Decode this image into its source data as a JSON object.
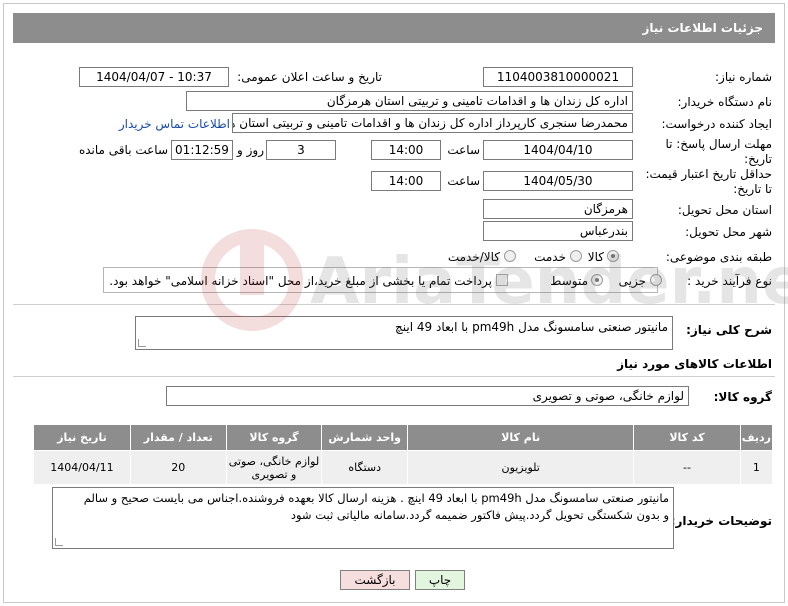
{
  "header": {
    "title": "جزئیات اطلاعات نیاز"
  },
  "fields": {
    "need_number_label": "شماره نیاز:",
    "need_number": "1104003810000021",
    "announce_label": "تاریخ و ساعت اعلان عمومی:",
    "announce_value": "1404/04/07 - 10:37",
    "buyer_org_label": "نام دستگاه خریدار:",
    "buyer_org": "اداره کل زندان ها و اقدامات تامینی و تربیتی استان هرمزگان",
    "requester_label": "ایجاد کننده درخواست:",
    "requester": "محمدرضا سنجری کارپرداز اداره کل زندان ها و اقدامات تامینی و تربیتی استان هرمزگان",
    "contact_link": "اطلاعات تماس خریدار",
    "reply_deadline_label": "مهلت ارسال پاسخ: تا تاریخ:",
    "reply_date": "1404/04/10",
    "time_label": "ساعت",
    "reply_time": "14:00",
    "days_value": "3",
    "days_label": "روز و",
    "remaining_time": "01:12:59",
    "remaining_label": "ساعت باقی مانده",
    "price_validity_label": "حداقل تاریخ اعتبار قیمت: تا تاریخ:",
    "price_date": "1404/05/30",
    "price_time": "14:00",
    "delivery_province_label": "استان محل تحویل:",
    "delivery_province": "هرمزگان",
    "delivery_city_label": "شهر محل تحویل:",
    "delivery_city": "بندرعباس",
    "category_label": "طبقه بندی موضوعی:",
    "category_goods": "کالا",
    "category_service": "خدمت",
    "category_goods_service": "کالا/خدمت",
    "process_label": "نوع فرآیند خرید :",
    "process_partial": "جزیی",
    "process_medium": "متوسط",
    "payment_note": "پرداخت تمام یا بخشی از مبلغ خرید،از محل \"اسناد خزانه اسلامی\" خواهد بود."
  },
  "description": {
    "label": "شرح کلی نیاز:",
    "value": "مانیتور صنعتی سامسونگ مدل pm49h با ابعاد 49 اینچ"
  },
  "goods_section": {
    "title": "اطلاعات کالاهای مورد نیاز",
    "group_label": "گروه کالا:",
    "group_value": "لوازم خانگی، صوتی و تصویری"
  },
  "table": {
    "headers": [
      "ردیف",
      "کد کالا",
      "نام کالا",
      "واحد شمارش",
      "گروه کالا",
      "تعداد / مقدار",
      "تاریخ نیاز"
    ],
    "rows": [
      [
        "1",
        "--",
        "تلویزیون",
        "دستگاه",
        "لوازم خانگی، صوتی و تصویری",
        "20",
        "1404/04/11"
      ]
    ]
  },
  "buyer_notes": {
    "label": "توضیحات خریدار:",
    "line1": "مانیتور صنعتی سامسونگ مدل pm49h با ابعاد 49 اینچ . هزینه ارسال کالا بعهده فروشنده.اجناس می بایست صحیح و سالم",
    "line2": "و بدون شکستگی تحویل گردد.پیش فاکتور ضمیمه گردد.سامانه مالیاتی ثبت شود"
  },
  "buttons": {
    "print": "چاپ",
    "back": "بازگشت"
  },
  "watermark": {
    "text": "AriaTender.neT"
  },
  "colors": {
    "header": "#8d8d8d",
    "link": "#1a4aa8",
    "back_button": "#f7dede",
    "print_button": "#e3f5df"
  }
}
